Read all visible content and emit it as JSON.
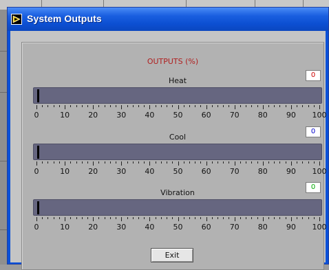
{
  "window": {
    "title": "System Outputs"
  },
  "panel": {
    "title": "OUTPUTS (%)"
  },
  "scale": {
    "labels": [
      "0",
      "10",
      "20",
      "30",
      "40",
      "50",
      "60",
      "70",
      "80",
      "90",
      "100"
    ]
  },
  "meters": [
    {
      "label": "Heat",
      "value": "0",
      "value_color": "#cc0000",
      "level_percent": 0
    },
    {
      "label": "Cool",
      "value": "0",
      "value_color": "#0000cc",
      "level_percent": 0
    },
    {
      "label": "Vibration",
      "value": "0",
      "value_color": "#00aa00",
      "level_percent": 0
    }
  ],
  "buttons": {
    "exit": "Exit"
  },
  "colors": {
    "bar_track": "#666680",
    "title_accent": "#b02020"
  }
}
